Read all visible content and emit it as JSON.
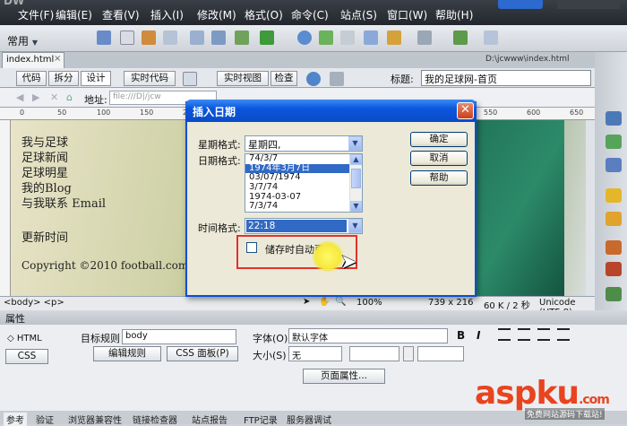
{
  "app": {
    "logo": "DW"
  },
  "menu": [
    "文件(F)",
    "编辑(E)",
    "查看(V)",
    "插入(I)",
    "修改(M)",
    "格式(O)",
    "命令(C)",
    "站点(S)",
    "窗口(W)",
    "帮助(H)"
  ],
  "toolbar": {
    "category": "常用"
  },
  "document": {
    "tab": "index.html",
    "path": "D:\\jcwww\\index.html",
    "views": {
      "code": "代码",
      "split": "拆分",
      "design": "设计",
      "live_code": "实时代码",
      "live_view": "实时视图",
      "inspect": "检查"
    },
    "title_label": "标题:",
    "title_value": "我的足球网-首页",
    "address_label": "地址:",
    "address_value": "file:///D|/jcw"
  },
  "ruler": [
    "0",
    "50",
    "100",
    "150",
    "200",
    "250",
    "300",
    "350",
    "400",
    "450",
    "500",
    "550",
    "600",
    "650"
  ],
  "page": {
    "nav": [
      "我与足球",
      "足球新闻",
      "足球明星",
      "我的Blog",
      "与我联系 Email"
    ],
    "update_time": "更新时间",
    "copyright": "Copyright ©2010 football.com Inc"
  },
  "status": {
    "tag_path": "<body> <p>",
    "zoom": "100%",
    "size": "739 x 216",
    "file_info": "60 K / 2 秒",
    "encoding": "Unicode (UTF-8)"
  },
  "properties": {
    "header": "属性",
    "html_btn": "HTML",
    "css_btn": "CSS",
    "target_rule_label": "目标规则",
    "target_rule_value": "body",
    "edit_rule": "编辑规则",
    "css_panel": "CSS 面板(P)",
    "font_label": "字体(O)",
    "font_value": "默认字体",
    "size_label": "大小(S)",
    "size_value": "无",
    "page_props": "页面属性...",
    "bold": "B",
    "italic": "I"
  },
  "bottom_tabs": [
    "参考",
    "验证",
    "浏览器兼容性",
    "链接检查器",
    "站点报告",
    "FTP记录",
    "服务器调试"
  ],
  "dialog": {
    "title": "插入日期",
    "weekday_label": "星期格式:",
    "weekday_value": "星期四,",
    "date_label": "日期格式:",
    "date_options": [
      "74/3/7",
      "1974年3月7日",
      "03/07/1974",
      "3/7/74",
      "1974-03-07",
      "7/3/74"
    ],
    "date_selected_index": 1,
    "time_label": "时间格式:",
    "time_value": "22:18",
    "auto_update_label": "储存时自动更新",
    "auto_update_checked": false,
    "ok": "确定",
    "cancel": "取消",
    "help": "帮助"
  },
  "watermark": {
    "main": "aspku",
    "tld": ".com",
    "sub": "免费网站源码下载站!"
  },
  "colors": {
    "dialog_title": "#0b56de",
    "selection": "#316ac5",
    "highlight_box": "#e2322c",
    "watermark": "#e8441f"
  }
}
